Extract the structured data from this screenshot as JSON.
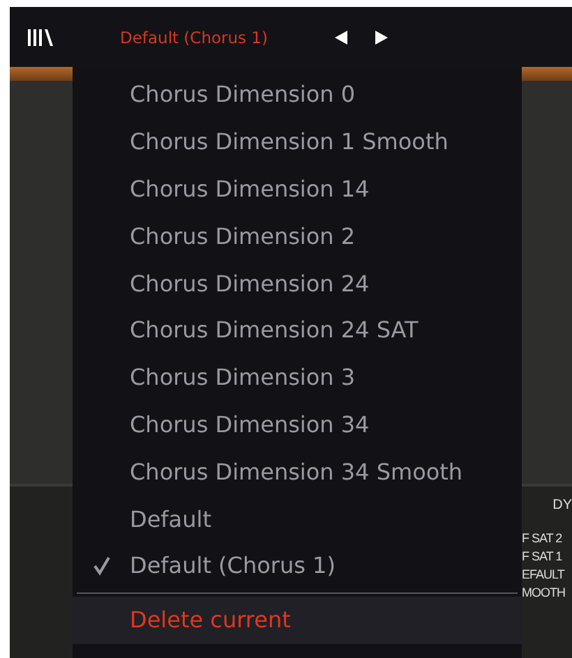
{
  "toolbar": {
    "preset_name": "Default (Chorus 1)"
  },
  "preset_menu": {
    "items": [
      {
        "label": "Chorus Dimension 0",
        "selected": false
      },
      {
        "label": "Chorus Dimension 1 Smooth",
        "selected": false
      },
      {
        "label": "Chorus Dimension 14",
        "selected": false
      },
      {
        "label": "Chorus Dimension 2",
        "selected": false
      },
      {
        "label": "Chorus Dimension 24",
        "selected": false
      },
      {
        "label": "Chorus Dimension 24 SAT",
        "selected": false
      },
      {
        "label": "Chorus Dimension 3",
        "selected": false
      },
      {
        "label": "Chorus Dimension 34",
        "selected": false
      },
      {
        "label": "Chorus Dimension 34 Smooth",
        "selected": false
      },
      {
        "label": "Default",
        "selected": false
      },
      {
        "label": "Default (Chorus 1)",
        "selected": true
      }
    ],
    "delete_action": "Delete current"
  },
  "background_panel": {
    "heading": "DY",
    "labels": [
      "F SAT 2",
      "F SAT 1",
      "EFAULT",
      "MOOTH"
    ]
  }
}
